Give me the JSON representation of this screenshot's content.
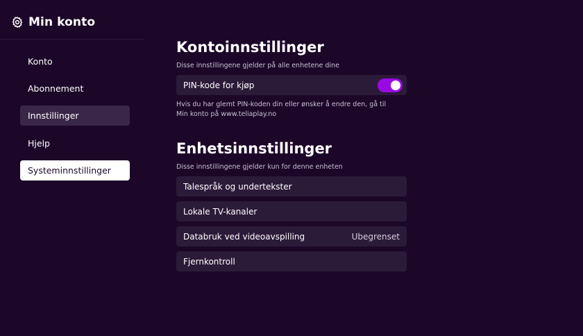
{
  "sidebar": {
    "title": "Min konto",
    "icon": "gear-icon",
    "items": [
      {
        "label": "Konto"
      },
      {
        "label": "Abonnement"
      },
      {
        "label": "Innstillinger"
      },
      {
        "label": "Hjelp"
      },
      {
        "label": "Systeminnstillinger"
      }
    ]
  },
  "account_settings": {
    "title": "Kontoinnstillinger",
    "subtitle": "Disse innstillingene gjelder på alle enhetene dine",
    "pin_row": {
      "label": "PIN-kode for kjøp",
      "toggle_on": true
    },
    "pin_note_line1": "Hvis du har glemt PIN-koden din eller ønsker å endre den, gå til",
    "pin_note_line2": "Min konto på www.teliaplay.no"
  },
  "device_settings": {
    "title": "Enhetsinnstillinger",
    "subtitle": "Disse innstillingene gjelder kun for denne enheten",
    "rows": [
      {
        "label": "Talespråk og undertekster",
        "value": ""
      },
      {
        "label": "Lokale TV-kanaler",
        "value": ""
      },
      {
        "label": "Databruk ved videoavspilling",
        "value": "Ubegrenset"
      },
      {
        "label": "Fjernkontroll",
        "value": ""
      }
    ]
  },
  "colors": {
    "background": "#1c0729",
    "row_background": "#2c1a39",
    "accent": "#990ae3",
    "nav_active": "#3a2647",
    "nav_focused": "#ffffff"
  }
}
